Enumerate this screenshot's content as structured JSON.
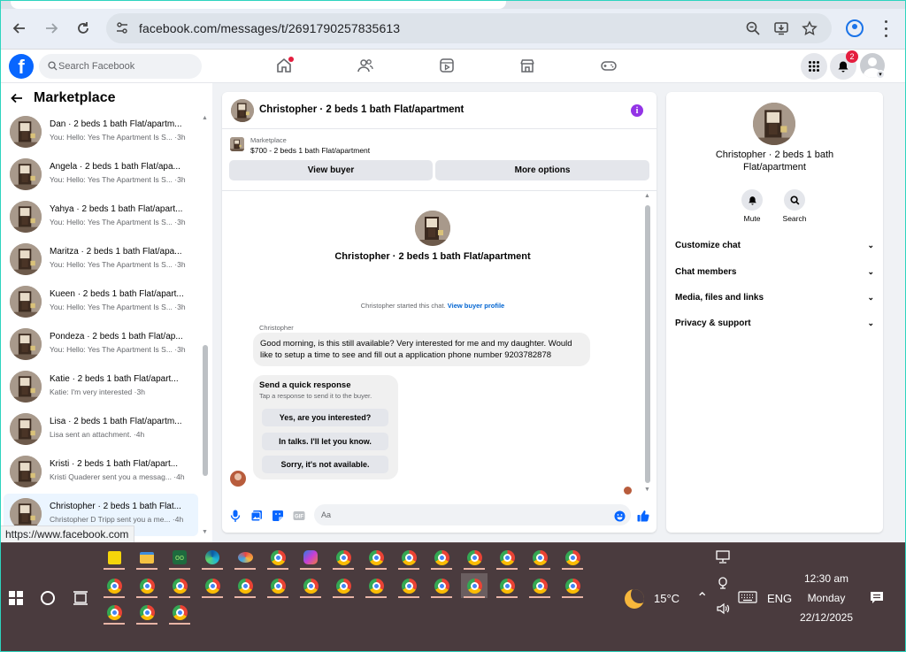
{
  "browser": {
    "url": "facebook.com/messages/t/2691790257835613",
    "status_url": "https://www.facebook.com"
  },
  "header": {
    "search_placeholder": "Search Facebook",
    "notification_count": "2",
    "brand_color": "#0866ff"
  },
  "sidebar": {
    "back_icon": "arrow-left-icon",
    "title": "Marketplace",
    "conversations": [
      {
        "title": "Dan · 2 beds 1 bath Flat/apartm...",
        "preview": "You: Hello: Yes The Apartment Is S... ·3h"
      },
      {
        "title": "Angela · 2 beds 1 bath Flat/apa...",
        "preview": "You: Hello: Yes The Apartment Is S... ·3h"
      },
      {
        "title": "Yahya · 2 beds 1 bath Flat/apart...",
        "preview": "You: Hello: Yes The Apartment Is S... ·3h"
      },
      {
        "title": "Maritza · 2 beds 1 bath Flat/apa...",
        "preview": "You: Hello: Yes The Apartment Is S... ·3h"
      },
      {
        "title": "Kueen · 2 beds 1 bath Flat/apart...",
        "preview": "You: Hello: Yes The Apartment Is S... ·3h"
      },
      {
        "title": "Pondeza · 2 beds 1 bath Flat/ap...",
        "preview": "You: Hello: Yes The Apartment Is S... ·3h"
      },
      {
        "title": "Katie · 2 beds 1 bath Flat/apart...",
        "preview": "Katie: I'm very interested ·3h"
      },
      {
        "title": "Lisa · 2 beds 1 bath Flat/apartm...",
        "preview": "Lisa sent an attachment. ·4h"
      },
      {
        "title": "Kristi · 2 beds 1 bath Flat/apart...",
        "preview": "Kristi Quaderer sent you a messag... ·4h"
      },
      {
        "title": "Christopher · 2 beds 1 bath Flat...",
        "preview": "Christopher D Tripp sent you a me... ·4h"
      }
    ]
  },
  "chat": {
    "header_name": "Christopher · 2 beds 1 bath Flat/apartment",
    "listing_category": "Marketplace",
    "listing_price_title": "$700 - 2 beds 1 bath Flat/apartment",
    "view_buyer_label": "View buyer",
    "more_options_label": "More options",
    "intro_name": "Christopher · 2 beds 1 bath Flat/apartment",
    "started_text": "Christopher started this chat.",
    "started_link": "View buyer profile",
    "sender_label": "Christopher",
    "message": "Good morning, is this still available? Very interested for me and my daughter. Would like to setup a time to see and fill out a application phone number 9203782878",
    "quick_title": "Send a quick response",
    "quick_subtitle": "Tap a response to send it to the buyer.",
    "quick_responses": [
      "Yes, are you interested?",
      "In talks. I'll let you know.",
      "Sorry, it's not available."
    ],
    "composer_placeholder": "Aa"
  },
  "info_panel": {
    "name": "Christopher · 2 beds 1 bath Flat/apartment",
    "mute_label": "Mute",
    "search_label": "Search",
    "sections": [
      "Customize chat",
      "Chat members",
      "Media, files and links",
      "Privacy & support"
    ]
  },
  "taskbar": {
    "temperature": "15°C",
    "language": "ENG",
    "time": "12:30 am",
    "day": "Monday",
    "date": "22/12/2025"
  }
}
